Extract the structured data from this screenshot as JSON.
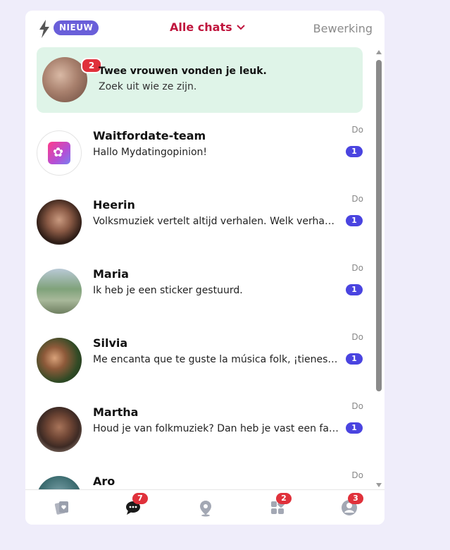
{
  "header": {
    "new_badge": "NIEUW",
    "title": "Alle chats",
    "edit": "Bewerking"
  },
  "likes": {
    "count": "2",
    "title": "Twee vrouwen vonden je leuk.",
    "subtitle": "Zoek uit wie ze zijn."
  },
  "chats": [
    {
      "name": "Waitfordate-team",
      "message": "Hallo Mydatingopinion!",
      "day": "Do",
      "unread": "1"
    },
    {
      "name": "Heerin",
      "message": "Volksmuziek vertelt altijd verhalen. Welk verhaal…",
      "day": "Do",
      "unread": "1"
    },
    {
      "name": "Maria",
      "message": "Ik heb je een sticker gestuurd.",
      "day": "Do",
      "unread": "1"
    },
    {
      "name": "Silvia",
      "message": "Me encanta que te guste la música folk, ¡tienes …",
      "day": "Do",
      "unread": "1"
    },
    {
      "name": "Martha",
      "message": "Houd je van folkmuziek? Dan heb je vast een fa…",
      "day": "Do",
      "unread": "1"
    },
    {
      "name": "Aro",
      "message": "",
      "day": "Do",
      "unread": ""
    }
  ],
  "nav": {
    "chats_badge": "7",
    "apps_badge": "2",
    "profile_badge": "3"
  },
  "colors": {
    "accent": "#c0163e",
    "brand": "#6a5fd9",
    "unread": "#4a44e0",
    "badge": "#e0313b",
    "likes_bg": "#dff4e8"
  }
}
